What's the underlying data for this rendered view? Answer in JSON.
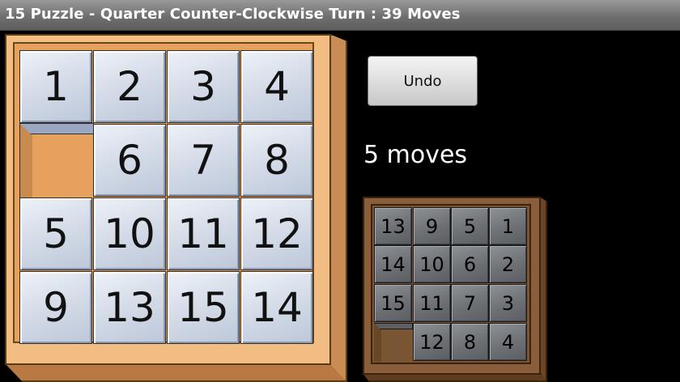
{
  "window": {
    "title": "15 Puzzle - Quarter Counter-Clockwise Turn : 39 Moves"
  },
  "controls": {
    "undo_label": "Undo",
    "moves_text": "5 moves"
  },
  "board": {
    "rows": [
      [
        "1",
        "2",
        "3",
        "4"
      ],
      [
        "",
        "6",
        "7",
        "8"
      ],
      [
        "5",
        "10",
        "11",
        "12"
      ],
      [
        "9",
        "13",
        "15",
        "14"
      ]
    ]
  },
  "target": {
    "rows": [
      [
        "13",
        "9",
        "5",
        "1"
      ],
      [
        "14",
        "10",
        "6",
        "2"
      ],
      [
        "15",
        "11",
        "7",
        "3"
      ],
      [
        "",
        "12",
        "8",
        "4"
      ]
    ]
  },
  "colors": {
    "board_frame": "#f1bd82",
    "tile_face": "#d6dde9",
    "target_frame": "#8a5e3a",
    "target_tile": "#6d7075"
  }
}
